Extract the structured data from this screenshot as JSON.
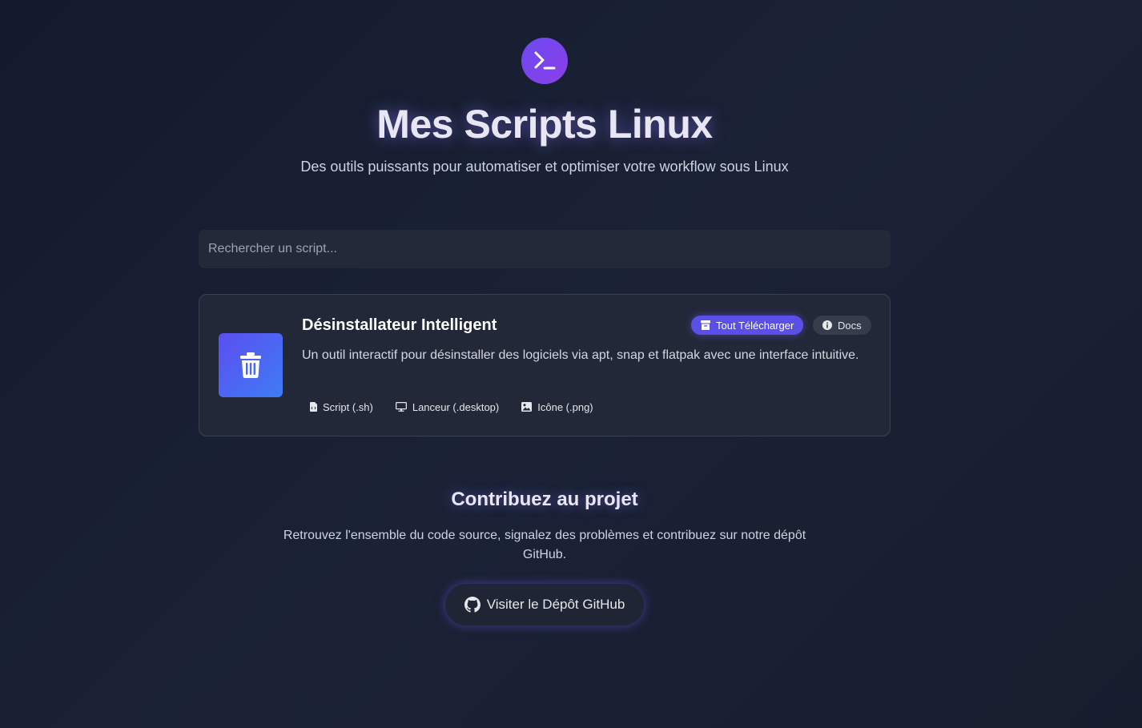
{
  "header": {
    "logo_icon": "terminal-icon",
    "title": "Mes Scripts Linux",
    "subtitle": "Des outils puissants pour automatiser et optimiser votre workflow sous Linux"
  },
  "search": {
    "placeholder": "Rechercher un script...",
    "value": ""
  },
  "scripts": [
    {
      "icon": "trash-icon",
      "title": "Désinstallateur Intelligent",
      "download_all_label": "Tout Télécharger",
      "docs_label": "Docs",
      "description": "Un outil interactif pour désinstaller des logiciels via apt, snap et flatpak avec une interface intuitive.",
      "files": [
        {
          "icon": "file-code-icon",
          "label": "Script (.sh)"
        },
        {
          "icon": "monitor-icon",
          "label": "Lanceur (.desktop)"
        },
        {
          "icon": "image-icon",
          "label": "Icône (.png)"
        }
      ]
    }
  ],
  "contribute": {
    "title": "Contribuez au projet",
    "text": "Retrouvez l'ensemble du code source, signalez des problèmes et contribuez sur notre dépôt GitHub.",
    "button_label": "Visiter le Dépôt GitHub",
    "button_icon": "github-icon"
  },
  "colors": {
    "accent": "#5a4fe6",
    "background": "#171d2d",
    "card": "#222838"
  }
}
